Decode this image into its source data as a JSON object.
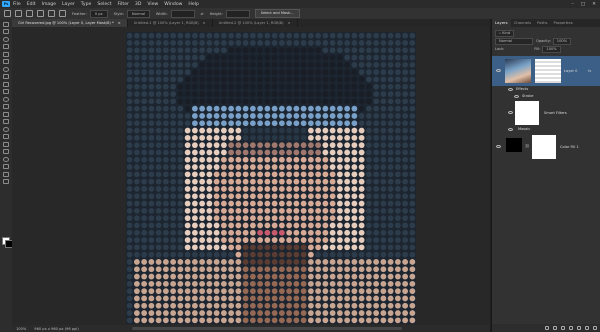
{
  "menu": {
    "logo": "Ps",
    "items": [
      "File",
      "Edit",
      "Image",
      "Layer",
      "Type",
      "Select",
      "Filter",
      "3D",
      "View",
      "Window",
      "Help"
    ]
  },
  "options_bar": {
    "feather_label": "Feather:",
    "feather_value": "0 px",
    "style_label": "Style:",
    "style_value": "Normal",
    "width_label": "Width:",
    "height_label": "Height:",
    "select_mask_button": "Select and Mask..."
  },
  "doc_tabs": [
    {
      "label": "Girl Recovered.jpg @ 100% (Layer 0, Layer Mask/8) *",
      "active": true
    },
    {
      "label": "Untitled-1 @ 100% (Layer 1, RGB/8)",
      "active": false
    },
    {
      "label": "Untitled-2 @ 100% (Layer 1, RGB/8)",
      "active": false
    }
  ],
  "status_bar": {
    "zoom": "100%",
    "doc_info": "960 px x 960 px (96 ppi)"
  },
  "layers_panel": {
    "tabs": [
      "Layers",
      "Channels",
      "Paths",
      "Properties"
    ],
    "search_kind": "Kind",
    "blend_mode": "Normal",
    "opacity_label": "Opacity:",
    "opacity_value": "100%",
    "lock_label": "Lock:",
    "fill_label": "Fill:",
    "fill_value": "100%",
    "layers": [
      {
        "name": "Layer 0",
        "selected": true
      },
      {
        "name": "Effects"
      },
      {
        "name": "Stroke"
      },
      {
        "name": "Smart Filters"
      },
      {
        "name": "Mosaic"
      },
      {
        "name": "Color Fill 1"
      }
    ]
  },
  "colors": {
    "accent": "#31a8ff",
    "selected_layer": "#3b5f86"
  }
}
